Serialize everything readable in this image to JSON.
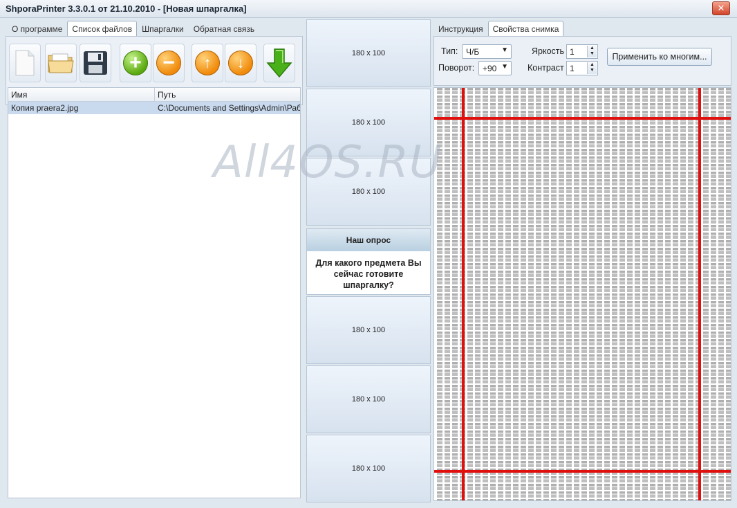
{
  "app": {
    "title": "ShporaPrinter 3.3.0.1 от 21.10.2010 - [Новая шпаргалка]"
  },
  "left_panel": {
    "tabs": [
      {
        "label": "О программе"
      },
      {
        "label": "Список файлов"
      },
      {
        "label": "Шпаргалки"
      },
      {
        "label": "Обратная связь"
      }
    ],
    "active_tab": "Список файлов",
    "toolbar": [
      {
        "icon": "new-document-icon"
      },
      {
        "icon": "open-folder-icon"
      },
      {
        "icon": "save-disk-icon"
      },
      {
        "icon": "add-icon"
      },
      {
        "icon": "remove-icon"
      },
      {
        "icon": "move-up-icon"
      },
      {
        "icon": "move-down-icon"
      },
      {
        "icon": "download-arrow-icon"
      }
    ],
    "file_list": {
      "columns": [
        "Имя",
        "Путь"
      ],
      "rows": [
        {
          "name": "Копия praera2.jpg",
          "path": "C:\\Documents and Settings\\Admin\\Рабо..."
        }
      ]
    }
  },
  "middle": {
    "slots": [
      "180 x 100",
      "180 x 100",
      "180 x 100",
      "180 x 100",
      "180 x 100",
      "180 x 100"
    ],
    "poll": {
      "header": "Наш опрос",
      "question": "Для какого предмета Вы сейчас готовите шпаргалку?"
    }
  },
  "right_panel": {
    "tabs": [
      {
        "label": "Инструкция"
      },
      {
        "label": "Свойства снимка"
      }
    ],
    "active_tab": "Свойства снимка",
    "type_label": "Тип:",
    "type_value": "Ч/Б",
    "rotation_label": "Поворот:",
    "rotation_value": "+90",
    "brightness_label": "Яркость",
    "brightness_value": "1",
    "contrast_label": "Контраст",
    "contrast_value": "1",
    "apply_button": "Применить ко многим..."
  },
  "watermark": "All4OS.RU",
  "colors": {
    "selection": "#c9d9ee",
    "marker_red": "#e0100f",
    "accent_green": "#5aa90f",
    "accent_orange": "#f08a0a"
  }
}
